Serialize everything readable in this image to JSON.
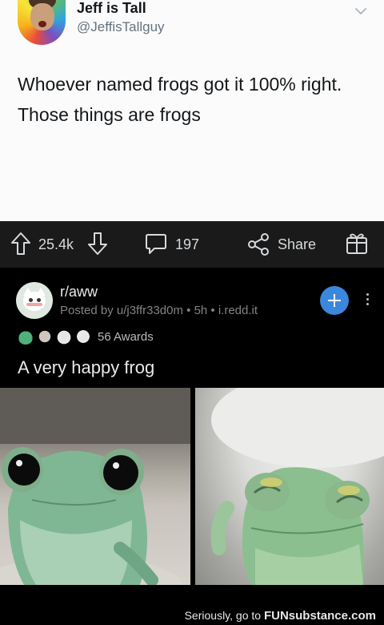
{
  "tweet": {
    "display_name": "Jeff is Tall",
    "handle": "@JeffisTallguy",
    "text": "Whoever named frogs got it 100% right. Those things are frogs"
  },
  "action_bar": {
    "vote_count": "25.4k",
    "comment_count": "197",
    "share_label": "Share",
    "icons": [
      "upvote-icon",
      "downvote-icon",
      "comment-icon",
      "share-icon",
      "award-icon"
    ]
  },
  "post": {
    "subreddit": "r/aww",
    "meta": "Posted by u/j3ffr33d0m • 5h • i.redd.it",
    "awards_count": "56 Awards",
    "title": "A very happy frog",
    "accent_color": "#3a87db"
  },
  "footer": {
    "prefix": "Seriously, go to ",
    "brand": "FUNsubstance.com"
  }
}
